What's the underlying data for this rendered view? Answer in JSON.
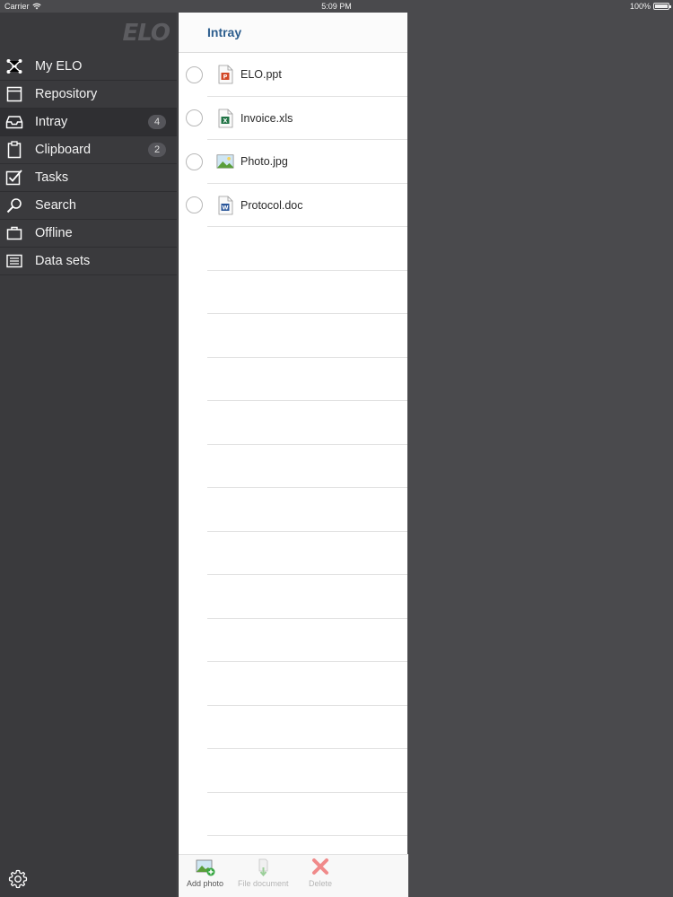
{
  "status": {
    "carrier": "Carrier",
    "time": "5:09 PM",
    "battery": "100%"
  },
  "sidebar": {
    "logo": "ELO",
    "items": [
      {
        "label": "My ELO",
        "icon": "network-icon"
      },
      {
        "label": "Repository",
        "icon": "repository-icon"
      },
      {
        "label": "Intray",
        "icon": "inbox-tray-icon",
        "badge": "4"
      },
      {
        "label": "Clipboard",
        "icon": "clipboard-icon",
        "badge": "2"
      },
      {
        "label": "Tasks",
        "icon": "checkbox-icon"
      },
      {
        "label": "Search",
        "icon": "search-icon"
      },
      {
        "label": "Offline",
        "icon": "briefcase-icon"
      },
      {
        "label": "Data sets",
        "icon": "list-icon"
      }
    ]
  },
  "panel": {
    "title": "Intray",
    "files": [
      {
        "name": "ELO.ppt",
        "type": "powerpoint-file-icon"
      },
      {
        "name": "Invoice.xls",
        "type": "excel-file-icon"
      },
      {
        "name": "Photo.jpg",
        "type": "image-file-icon"
      },
      {
        "name": "Protocol.doc",
        "type": "word-file-icon"
      }
    ]
  },
  "toolbar": {
    "add_photo": "Add photo",
    "file_document": "File document",
    "delete": "Delete"
  },
  "colors": {
    "sidebar_bg": "#3a3a3d",
    "header_title": "#2d5e8e",
    "background": "#4a4a4d"
  }
}
